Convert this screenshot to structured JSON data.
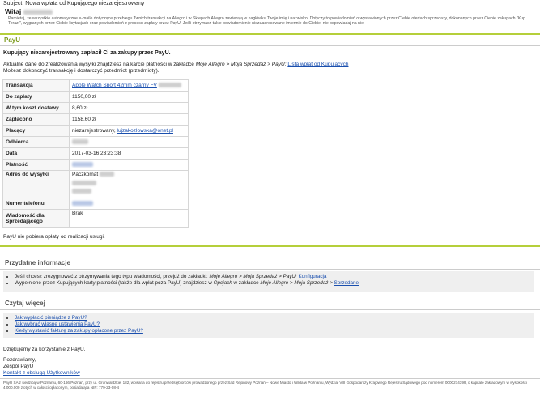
{
  "subject_label": "Subject:",
  "subject_text": "Nowa wpłata od Kupującego niezarejestrowany",
  "greeting": "Witaj",
  "notice": "Pamiętaj, że wszystkie automatyczne e-maile dotyczące przebiegu Twoich transakcji na Allegro i w Sklepach Allegro zawierają w nagłówku Twoje imię i nazwisko. Dotyczy to powiadomień o wystawionych przez Ciebie ofertach sprzedaży, dokonanych przez Ciebie zakupach \"Kup Teraz!\", wygranych przez Ciebie licytacjach oraz powiadomień z procesu zapłaty przez PayU. Jeśli otrzymasz takie powiadomienie niezaadresowane imiennie do Ciebie, nie odpowiadaj na nie.",
  "payu_title": "PayU",
  "paid_heading": "Kupujący niezarejestrowany zapłacił Ci za zakupy przez PayU.",
  "info_line1": "Aktualne dane do zrealizowania wysyłki znajdziesz na karcie płatności w zakładce",
  "info_path": "Moje Allegro > Moja Sprzedaż > PayU:",
  "info_link": "Lista wpłat od Kupujących",
  "info_line2": "Możesz dokończyć transakcję i dostarczyć przedmiot (przedmioty).",
  "rows": [
    {
      "key": "Transakcja",
      "value": "Apple Watch Sport 42mm czarny FV"
    },
    {
      "key": "Do zapłaty",
      "value": "1150,00 zł"
    },
    {
      "key": "W tym koszt dostawy",
      "value": "8,60 zł"
    },
    {
      "key": "Zapłacono",
      "value": "1158,60 zł"
    },
    {
      "key": "Płacący",
      "value": "niezarejestrowany,",
      "link": "lujzakozlowska@onet.pl"
    },
    {
      "key": "Odbiorca",
      "value": ""
    },
    {
      "key": "Data",
      "value": "2017-03-16 23:23:38"
    },
    {
      "key": "Płatność",
      "value": ""
    },
    {
      "key": "Adres do wysyłki",
      "value": "Paczkomat"
    },
    {
      "key": "Numer telefonu",
      "value": ""
    },
    {
      "key": "Wiadomość dla Sprzedającego",
      "value": "Brak"
    }
  ],
  "no_fee": "PayU nie pobiera opłaty od realizacji usługi.",
  "useful_title": "Przydatne informacje",
  "useful_1_text": "Jeśli chcesz zrezygnować z otrzymywania tego typu wiadomości, przejdź do zakładki:",
  "useful_1_path": "Moje Allegro > Moja Sprzedaż > PayU:",
  "useful_1_link": "Konfiguracja",
  "useful_2_text": "Wypełnione przez Kupujących karty płatności (także dla wpłat poza PayU) znajdziesz w",
  "useful_2_em1": "Opcjach",
  "useful_2_mid": "w zakładce",
  "useful_2_path": "Moje Allegro > Moja Sprzedaż >",
  "useful_2_link": "Sprzedane",
  "read_title": "Czytaj więcej",
  "read_links": [
    "Jak wypłacić pieniądze z PayU?",
    "Jak wybrać własne ustawienia PayU?",
    "Kiedy wystawić fakturę za zakupy opłacone przez PayU?"
  ],
  "thanks": "Dziękujemy za korzystanie z PayU.",
  "regards": "Pozdrawiamy,",
  "team": "Zespół PayU",
  "contact_link": "Kontakt z obsługą Użytkowników",
  "footer": "PayU SA z siedzibą w Poznaniu, 60-166 Poznań, przy ul. Grunwaldzkiej 182, wpisana do rejestru przedsiębiorców prowadzonego przez Sąd Rejonowy Poznań – Nowe Miasto i Wilda w Poznaniu, Wydział VIII Gospodarczy Krajowego Rejestru Sądowego pod numerem 0000274399, o kapitale zakładowym w wysokości 4.000.000 złotych w całości opłaconym, posiadająca NIP: 779-23-08-4",
  "colors": {
    "accent_green": "#b5cf3a",
    "link_blue": "#1a4fae",
    "title_green": "#7b9a1c"
  }
}
